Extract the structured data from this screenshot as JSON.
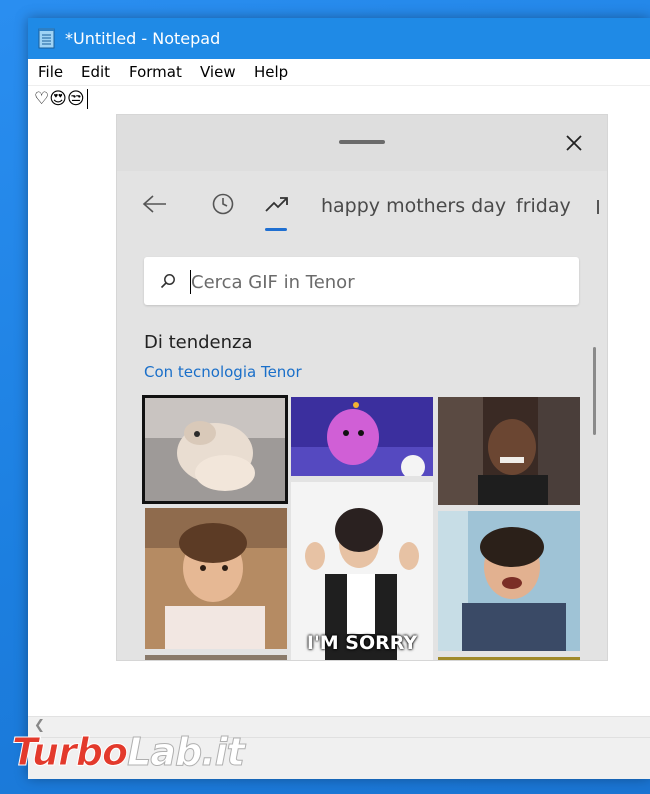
{
  "window": {
    "title": "*Untitled - Notepad",
    "accent": "#1f8ae6"
  },
  "menu": {
    "items": [
      "File",
      "Edit",
      "Format",
      "View",
      "Help"
    ]
  },
  "editor": {
    "content": "♡😍😒"
  },
  "emoji_panel": {
    "tabs": {
      "back_icon": "back-arrow-icon",
      "recent_icon": "clock-icon",
      "trending_icon": "trending-icon",
      "term1": "happy mothers day",
      "term2": "friday"
    },
    "search": {
      "placeholder": "Cerca GIF in Tenor"
    },
    "section_title": "Di tendenza",
    "powered_by": "Con tecnologia Tenor",
    "gifs": [
      {
        "description": "pug sleeping"
      },
      {
        "description": "purple cartoon character"
      },
      {
        "description": "man laughing"
      },
      {
        "description": "little girl talking"
      },
      {
        "description": "woman waving",
        "caption": "I'M SORRY"
      },
      {
        "description": "boy laughing"
      }
    ]
  },
  "watermark": {
    "part1": "Turbo",
    "part2": "Lab.it"
  }
}
